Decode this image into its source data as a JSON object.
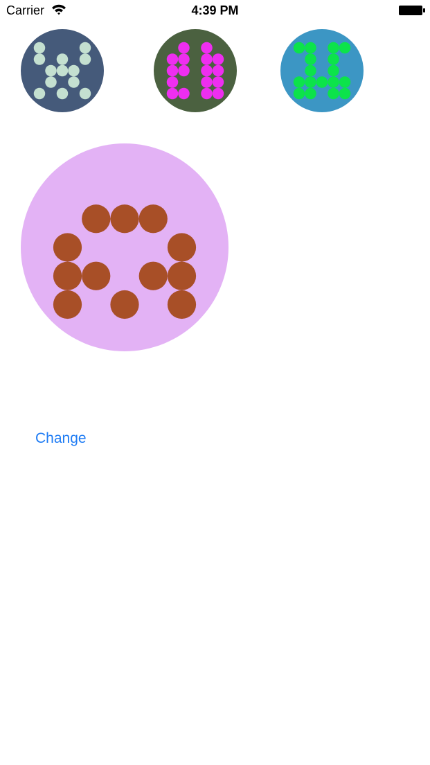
{
  "status_bar": {
    "carrier": "Carrier",
    "time": "4:39 PM",
    "icons": [
      "wifi-icon",
      "battery-icon"
    ]
  },
  "avatars": [
    {
      "name": "avatar-small-1",
      "background": "#455a7a",
      "dot_color": "#c4e0d0",
      "pattern": [
        [
          1,
          0,
          0,
          0,
          1
        ],
        [
          1,
          0,
          1,
          0,
          1
        ],
        [
          0,
          1,
          1,
          1,
          0
        ],
        [
          0,
          1,
          0,
          1,
          0
        ],
        [
          1,
          0,
          1,
          0,
          1
        ]
      ]
    },
    {
      "name": "avatar-small-2",
      "background": "#4b6140",
      "dot_color": "#ee2ef0",
      "pattern": [
        [
          0,
          1,
          0,
          1,
          0
        ],
        [
          1,
          1,
          0,
          1,
          1
        ],
        [
          1,
          1,
          0,
          1,
          1
        ],
        [
          1,
          0,
          0,
          1,
          1
        ],
        [
          1,
          1,
          0,
          1,
          1
        ]
      ]
    },
    {
      "name": "avatar-small-3",
      "background": "#3c96c4",
      "dot_color": "#0ce34a",
      "pattern": [
        [
          1,
          1,
          0,
          1,
          1
        ],
        [
          0,
          1,
          0,
          1,
          0
        ],
        [
          0,
          1,
          0,
          1,
          0
        ],
        [
          1,
          1,
          1,
          1,
          1
        ],
        [
          1,
          1,
          0,
          1,
          1
        ]
      ]
    },
    {
      "name": "avatar-large",
      "background": "#e3b2f5",
      "dot_color": "#a84f27",
      "pattern": [
        [
          0,
          0,
          0,
          0,
          0
        ],
        [
          0,
          1,
          1,
          1,
          0
        ],
        [
          1,
          0,
          0,
          0,
          1
        ],
        [
          1,
          1,
          0,
          1,
          1
        ],
        [
          1,
          0,
          1,
          0,
          1
        ]
      ]
    }
  ],
  "change_button": {
    "label": "Change"
  }
}
